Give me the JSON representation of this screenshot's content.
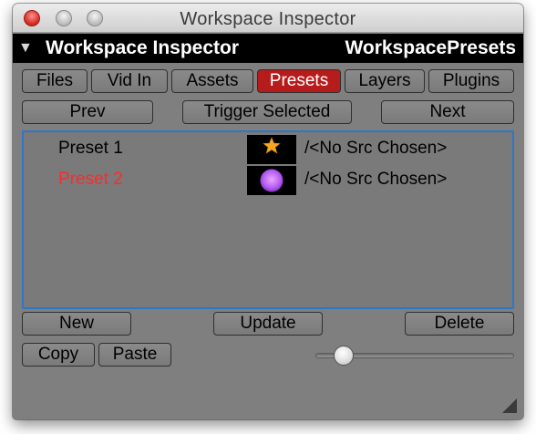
{
  "window": {
    "title": "Workspace Inspector"
  },
  "header": {
    "title": "Workspace Inspector",
    "section": "WorkspacePresets"
  },
  "tabs": [
    {
      "label": "Files",
      "active": false
    },
    {
      "label": "Vid In",
      "active": false
    },
    {
      "label": "Assets",
      "active": false
    },
    {
      "label": "Presets",
      "active": true
    },
    {
      "label": "Layers",
      "active": false
    },
    {
      "label": "Plugins",
      "active": false
    }
  ],
  "nav": {
    "prev_label": "Prev",
    "trigger_label": "Trigger Selected",
    "next_label": "Next"
  },
  "presets": [
    {
      "name": "Preset 1",
      "source": "/<No Src Chosen>",
      "thumbnail": "orange-star",
      "highlighted": false
    },
    {
      "name": "Preset 2",
      "source": "/<No Src Chosen>",
      "thumbnail": "purple-circle",
      "highlighted": true
    }
  ],
  "actions": {
    "new_label": "New",
    "update_label": "Update",
    "delete_label": "Delete",
    "copy_label": "Copy",
    "paste_label": "Paste"
  },
  "slider": {
    "level": 0.14
  },
  "colors": {
    "active_tab": "#b71c1c",
    "highlight_text": "#ff2a2a",
    "list_border": "#2f76c9",
    "panel_bg": "#7f7f7f"
  }
}
